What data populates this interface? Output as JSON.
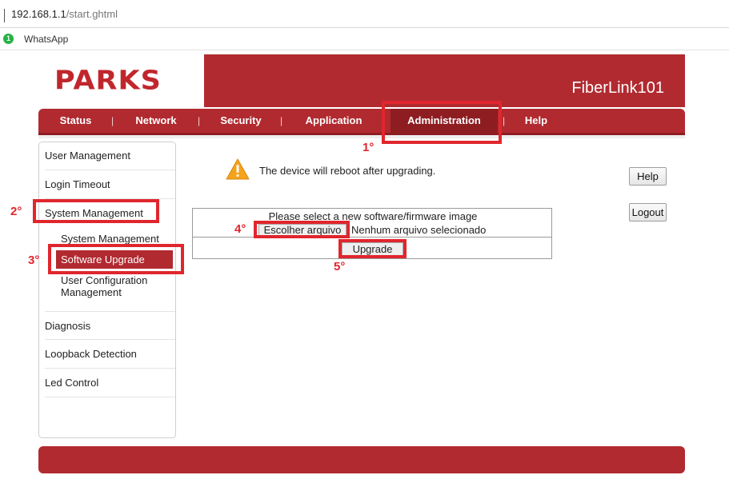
{
  "browser": {
    "url_host": "192.168.1.1",
    "url_path": "/start.ghtml",
    "bookmark_badge": "1",
    "bookmark_label": "WhatsApp"
  },
  "header": {
    "logo_text": "PARKS",
    "model": "FiberLink101",
    "brand_color": "#b12a30"
  },
  "nav": {
    "items": [
      "Status",
      "Network",
      "Security",
      "Application",
      "Administration",
      "Help"
    ],
    "separator": "|",
    "active": "Administration"
  },
  "sidebar": {
    "items": [
      "User Management",
      "Login Timeout",
      "System Management",
      "Diagnosis",
      "Loopback Detection",
      "Led Control"
    ],
    "subitems": [
      "System Management",
      "Software Upgrade",
      "User Configuration Management"
    ],
    "active_sub": "Software Upgrade"
  },
  "main": {
    "warning_icon": "warning-icon",
    "warning_text": "The device will reboot after upgrading.",
    "help_label": "Help",
    "logout_label": "Logout",
    "form_title": "Please select a new software/firmware image",
    "file_button_label": "Escolher arquivo",
    "file_status": "Nenhum arquivo selecionado",
    "upgrade_label": "Upgrade"
  },
  "annotations": {
    "labels": [
      "1°",
      "2°",
      "3°",
      "4°",
      "5°"
    ],
    "color": "#e0262d"
  }
}
